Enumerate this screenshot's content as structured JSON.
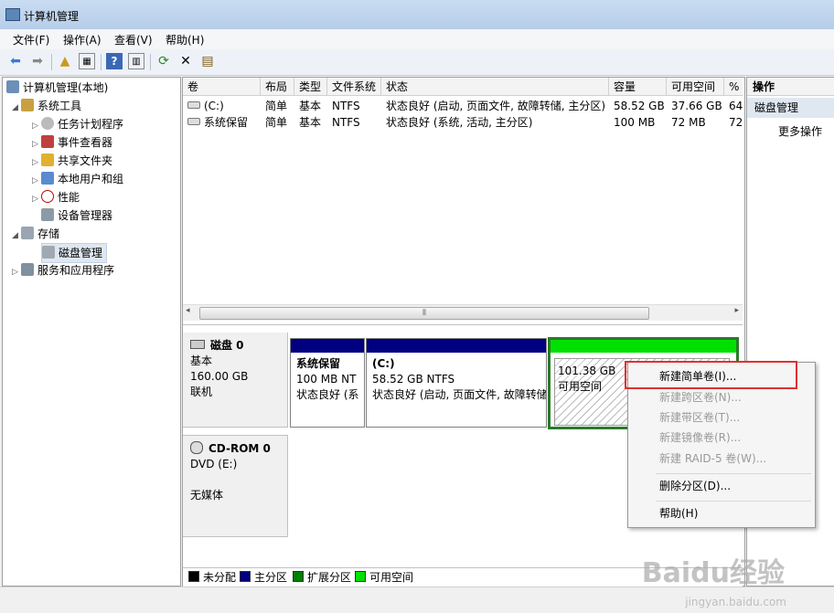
{
  "window": {
    "title": "计算机管理"
  },
  "menu": [
    "文件(F)",
    "操作(A)",
    "查看(V)",
    "帮助(H)"
  ],
  "tree": {
    "root": "计算机管理(本地)",
    "system_tools": "系统工具",
    "task_scheduler": "任务计划程序",
    "event_viewer": "事件查看器",
    "shared_folders": "共享文件夹",
    "local_users": "本地用户和组",
    "performance": "性能",
    "device_manager": "设备管理器",
    "storage": "存储",
    "disk_management": "磁盘管理",
    "services_apps": "服务和应用程序"
  },
  "volumes": {
    "headers": [
      "卷",
      "布局",
      "类型",
      "文件系统",
      "状态",
      "容量",
      "可用空间",
      "%"
    ],
    "rows": [
      [
        "(C:)",
        "简单",
        "基本",
        "NTFS",
        "状态良好 (启动, 页面文件, 故障转储, 主分区)",
        "58.52 GB",
        "37.66 GB",
        "64"
      ],
      [
        "系统保留",
        "简单",
        "基本",
        "NTFS",
        "状态良好 (系统, 活动, 主分区)",
        "100 MB",
        "72 MB",
        "72"
      ]
    ]
  },
  "disk0": {
    "name": "磁盘 0",
    "type": "基本",
    "size": "160.00 GB",
    "status": "联机",
    "part1": {
      "name": "系统保留",
      "size": "100 MB NT",
      "status": "状态良好 (系"
    },
    "part2": {
      "name": "(C:)",
      "size": "58.52 GB NTFS",
      "status": "状态良好 (启动, 页面文件, 故障转储"
    },
    "free": {
      "size": "101.38 GB",
      "label": "可用空间"
    }
  },
  "cdrom": {
    "name": "CD-ROM 0",
    "drive": "DVD (E:)",
    "media": "无媒体"
  },
  "legend": [
    "未分配",
    "主分区",
    "扩展分区",
    "可用空间"
  ],
  "actions": {
    "header": "操作",
    "section": "磁盘管理",
    "more": "更多操作"
  },
  "context_menu": {
    "new_simple": "新建简单卷(I)...",
    "new_spanned": "新建跨区卷(N)...",
    "new_striped": "新建带区卷(T)...",
    "new_mirrored": "新建镜像卷(R)...",
    "new_raid5": "新建 RAID-5 卷(W)...",
    "delete_partition": "删除分区(D)...",
    "help": "帮助(H)"
  },
  "watermark": {
    "brand": "Baidu经验",
    "url": "jingyan.baidu.com"
  },
  "colors": {
    "unallocated": "#000000",
    "primary": "#000080",
    "extended": "#008000",
    "free": "#00e000",
    "highlight": "#e03030"
  }
}
